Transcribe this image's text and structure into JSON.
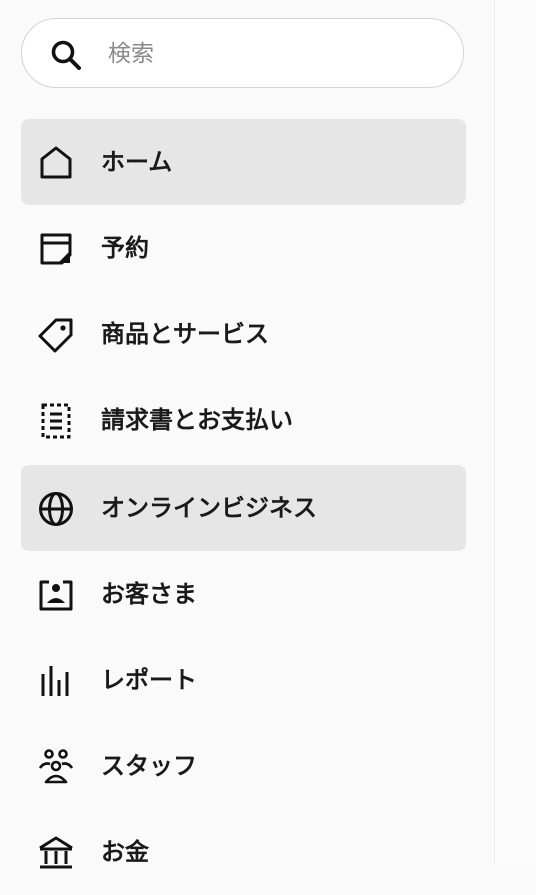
{
  "search": {
    "placeholder": "検索",
    "icon": "search-icon"
  },
  "nav": {
    "items": [
      {
        "label": "ホーム",
        "icon": "home-icon",
        "active": true
      },
      {
        "label": "予約",
        "icon": "calendar-icon",
        "active": false
      },
      {
        "label": "商品とサービス",
        "icon": "tag-icon",
        "active": false
      },
      {
        "label": "請求書とお支払い",
        "icon": "invoice-icon",
        "active": false
      },
      {
        "label": "オンラインビジネス",
        "icon": "globe-icon",
        "active": true
      },
      {
        "label": "お客さま",
        "icon": "customer-card-icon",
        "active": false
      },
      {
        "label": "レポート",
        "icon": "bar-chart-icon",
        "active": false
      },
      {
        "label": "スタッフ",
        "icon": "team-icon",
        "active": false
      },
      {
        "label": "お金",
        "icon": "bank-icon",
        "active": false
      }
    ]
  },
  "colors": {
    "sidebar_bg": "#fafafa",
    "active_bg": "#e6e6e6",
    "text": "#1a1a1a",
    "placeholder": "#8a8a8a"
  }
}
